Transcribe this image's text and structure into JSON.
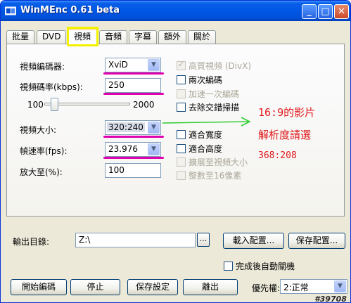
{
  "window": {
    "title": "WinMEnc 0.61 beta",
    "minimize_glyph": "_",
    "maximize_glyph": "□",
    "close_glyph": "✕"
  },
  "tabs": [
    "批量",
    "DVD",
    "視頻",
    "音頻",
    "字幕",
    "額外",
    "關於"
  ],
  "video": {
    "codec_label": "視頻編碼器:",
    "codec_value": "XviD",
    "bitrate_label": "視頻碼率(kbps):",
    "bitrate_value": "250",
    "slider_min": "100",
    "slider_max": "2000",
    "size_label": "視頻大小:",
    "size_value": "320:240",
    "fps_label": "幀速率(fps):",
    "fps_value": "23.976",
    "zoom_label": "放大至(%):",
    "zoom_value": "100"
  },
  "options": {
    "hq": "高質視頻 (DivX)",
    "two_pass": "兩次編碼",
    "fast_first": "加速一次編碼",
    "deinterlace": "去除交錯掃描",
    "fit_width": "適合寬度",
    "fit_height": "適合高度",
    "expand": "擴展至視頻大小",
    "div16": "整數至16像素"
  },
  "annotation": {
    "line1": "16:9的影片",
    "line2": "解析度請選",
    "line3": "368:208",
    "color": "#e0181a",
    "underline_color": "#e000b0"
  },
  "output": {
    "label": "輸出目錄:",
    "value": "Z:\\",
    "browse": "...",
    "load_config": "載入配置...",
    "save_config": "保存配置...",
    "auto_close": "完成後自動關機"
  },
  "actions": {
    "start": "開始編碼",
    "stop": "停止",
    "save_settings": "保存設定",
    "exit": "離出",
    "priority_label": "優先權:",
    "priority_value": "2:正常"
  },
  "watermark": "#39708"
}
